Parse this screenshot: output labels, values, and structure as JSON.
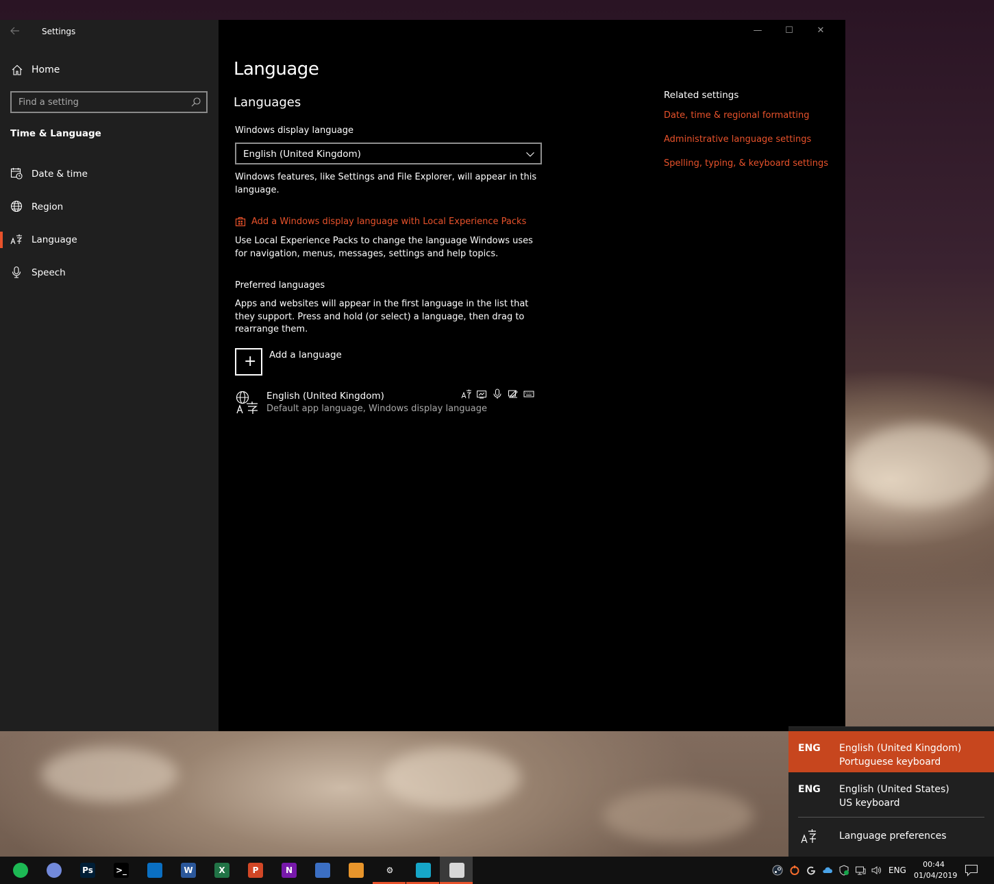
{
  "window": {
    "app_title": "Settings",
    "controls": {
      "minimize": "—",
      "maximize": "☐",
      "close": "✕"
    }
  },
  "sidebar": {
    "home_label": "Home",
    "search_placeholder": "Find a setting",
    "section_title": "Time & Language",
    "items": [
      {
        "label": "Date & time",
        "icon": "calendar-clock-icon"
      },
      {
        "label": "Region",
        "icon": "globe-icon"
      },
      {
        "label": "Language",
        "icon": "language-icon",
        "active": true
      },
      {
        "label": "Speech",
        "icon": "microphone-icon"
      }
    ]
  },
  "main": {
    "title": "Language",
    "languages_heading": "Languages",
    "display_language_label": "Windows display language",
    "display_language_value": "English (United Kingdom)",
    "display_language_desc": "Windows features, like Settings and File Explorer, will appear in this language.",
    "lxp_link": "Add a Windows display language with Local Experience Packs",
    "lxp_desc": "Use Local Experience Packs to change the language Windows uses for navigation, menus, messages, settings and help topics.",
    "preferred_label": "Preferred languages",
    "preferred_desc": "Apps and websites will appear in the first language in the list that they support. Press and hold (or select) a language, then drag to rearrange them.",
    "add_language": "Add a language",
    "installed": [
      {
        "name": "English (United Kingdom)",
        "sub": "Default app language, Windows display language"
      }
    ]
  },
  "related": {
    "heading": "Related settings",
    "links": [
      "Date, time & regional formatting",
      "Administrative language settings",
      "Spelling, typing, & keyboard settings"
    ]
  },
  "flyout": {
    "items": [
      {
        "abbr": "ENG",
        "line1": "English (United Kingdom)",
        "line2": "Portuguese keyboard",
        "selected": true
      },
      {
        "abbr": "ENG",
        "line1": "English (United States)",
        "line2": "US keyboard",
        "selected": false
      }
    ],
    "preferences": "Language preferences"
  },
  "taskbar": {
    "apps": [
      {
        "name": "spotify",
        "glyph": "",
        "color": "#1db954"
      },
      {
        "name": "discord",
        "glyph": "",
        "color": "#7289da"
      },
      {
        "name": "photoshop",
        "glyph": "Ps",
        "color": "#001e36"
      },
      {
        "name": "terminal",
        "glyph": ">_",
        "color": "#000000"
      },
      {
        "name": "vscode",
        "glyph": "",
        "color": "#0a6fc2"
      },
      {
        "name": "word",
        "glyph": "W",
        "color": "#2b579a"
      },
      {
        "name": "excel",
        "glyph": "X",
        "color": "#217346"
      },
      {
        "name": "powerpoint",
        "glyph": "P",
        "color": "#d24726"
      },
      {
        "name": "onenote",
        "glyph": "N",
        "color": "#7719aa"
      },
      {
        "name": "tower",
        "glyph": "",
        "color": "#3b6fc4"
      },
      {
        "name": "paint",
        "glyph": "",
        "color": "#e8952b"
      },
      {
        "name": "settings",
        "glyph": "⚙",
        "color": "#111111"
      },
      {
        "name": "screen-app",
        "glyph": "",
        "color": "#16a6c8"
      },
      {
        "name": "snip-app",
        "glyph": "",
        "color": "#d8d8d8"
      }
    ],
    "tray_lang": "ENG",
    "time": "00:44",
    "date": "01/04/2019"
  },
  "colors": {
    "accent": "#e8522b",
    "flyout_selected": "#c7461e"
  }
}
